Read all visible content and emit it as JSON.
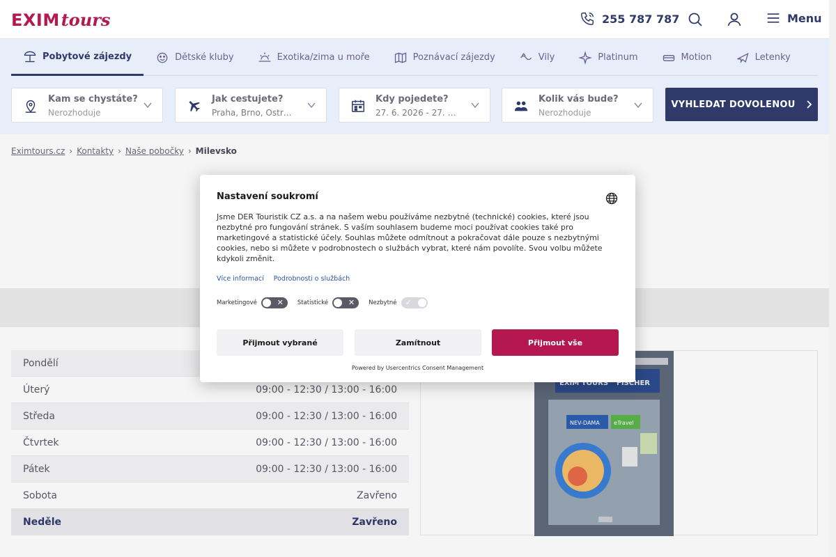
{
  "header": {
    "logo_main": "EXIM",
    "logo_script": "tours",
    "phone": "255 787 787",
    "menu_label": "Menu"
  },
  "tabs": [
    {
      "label": "Pobytové zájezdy",
      "icon": "beach-umbrella-icon",
      "active": true
    },
    {
      "label": "Dětské kluby",
      "icon": "smiley-icon",
      "active": false
    },
    {
      "label": "Exotika/zima u moře",
      "icon": "sun-icon",
      "active": false
    },
    {
      "label": "Poznávací zájezdy",
      "icon": "map-icon",
      "active": false
    },
    {
      "label": "Vily",
      "icon": "villa-icon",
      "active": false
    },
    {
      "label": "Platinum",
      "icon": "sparkle-icon",
      "active": false
    },
    {
      "label": "Motion",
      "icon": "bed-icon",
      "active": false
    },
    {
      "label": "Letenky",
      "icon": "plane-icon",
      "active": false
    }
  ],
  "search": {
    "destination": {
      "title": "Kam se chystáte?",
      "value": "Nerozhoduje"
    },
    "departure": {
      "title": "Jak cestujete?",
      "value": "Praha, Brno, Ostr…"
    },
    "dates": {
      "title": "Kdy pojedete?",
      "value": "27. 6. 2026 - 27. 8…"
    },
    "travelers": {
      "title": "Kolik vás bude?",
      "value": "Nerozhoduje"
    },
    "button": "VYHLEDAT DOVOLENOU"
  },
  "breadcrumb": [
    "Eximtours.cz",
    "Kontakty",
    "Naše pobočky",
    "Milevsko"
  ],
  "hours": [
    {
      "day": "Pondělí",
      "time": ""
    },
    {
      "day": "Úterý",
      "time": "09:00 - 12:30 / 13:00 - 16:00"
    },
    {
      "day": "Středa",
      "time": "09:00 - 12:30 / 13:00 - 16:00"
    },
    {
      "day": "Čtvrtek",
      "time": "09:00 - 12:30 / 13:00 - 16:00"
    },
    {
      "day": "Pátek",
      "time": "09:00 - 12:30 / 13:00 - 16:00"
    },
    {
      "day": "Sobota",
      "time": "Zavřeno"
    },
    {
      "day": "Neděle",
      "time": "Zavřeno"
    }
  ],
  "consent": {
    "title": "Nastavení soukromí",
    "text": "Jsme DER Touristik CZ a.s. a na našem webu používáme nezbytné (technické) cookies, které jsou nezbytné pro fungování stránek. S vaším souhlasem budeme moci používat cookies také pro marketingové a statistické účely. Souhlas můžete odmítnout a pokračovat dále pouze s nezbytnými cookies, nebo si můžete v podrobnostech o službách vybrat, které nám povolíte. Svou volbu můžete kdykoli změnit.",
    "link_more": "Více informací",
    "link_details": "Podrobnosti o službách",
    "toggles": [
      {
        "label": "Marketingové",
        "state": "off"
      },
      {
        "label": "Statistické",
        "state": "off"
      },
      {
        "label": "Nezbytné",
        "state": "on"
      }
    ],
    "btn_accept_selected": "Přijmout vybrané",
    "btn_reject": "Zamítnout",
    "btn_accept_all": "Přijmout vše",
    "powered_by": "Powered by Usercentrics Consent Management"
  },
  "photo": {
    "sign_left": "EXIM TOURS",
    "sign_right": "FISCHER",
    "sticker_left": "NEV-DAMA",
    "sticker_right": "eTravel"
  },
  "colors": {
    "brand_pink": "#b5174f",
    "navy": "#2f3a6b",
    "band_blue": "#e7eefa"
  }
}
